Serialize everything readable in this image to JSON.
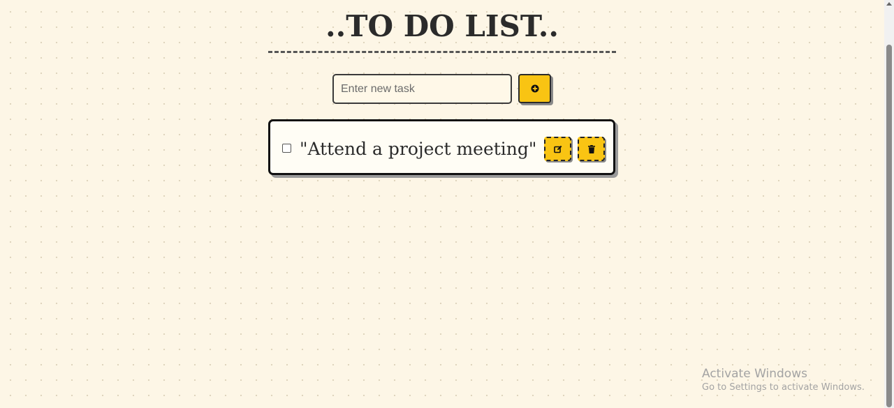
{
  "app": {
    "title": "..TO DO LIST.."
  },
  "new_task": {
    "placeholder": "Enter new task",
    "value": ""
  },
  "add_button": {
    "icon": "plus-circle-icon"
  },
  "tasks": [
    {
      "text": "\"Attend a project meeting\"",
      "completed": false,
      "edit_icon": "edit-icon",
      "delete_icon": "trash-icon"
    }
  ],
  "watermark": {
    "title": "Activate Windows",
    "subtitle": "Go to Settings to activate Windows."
  },
  "colors": {
    "background": "#fdf6e6",
    "accent": "#f9c413",
    "border": "#111111",
    "text": "#2b2b2b"
  }
}
